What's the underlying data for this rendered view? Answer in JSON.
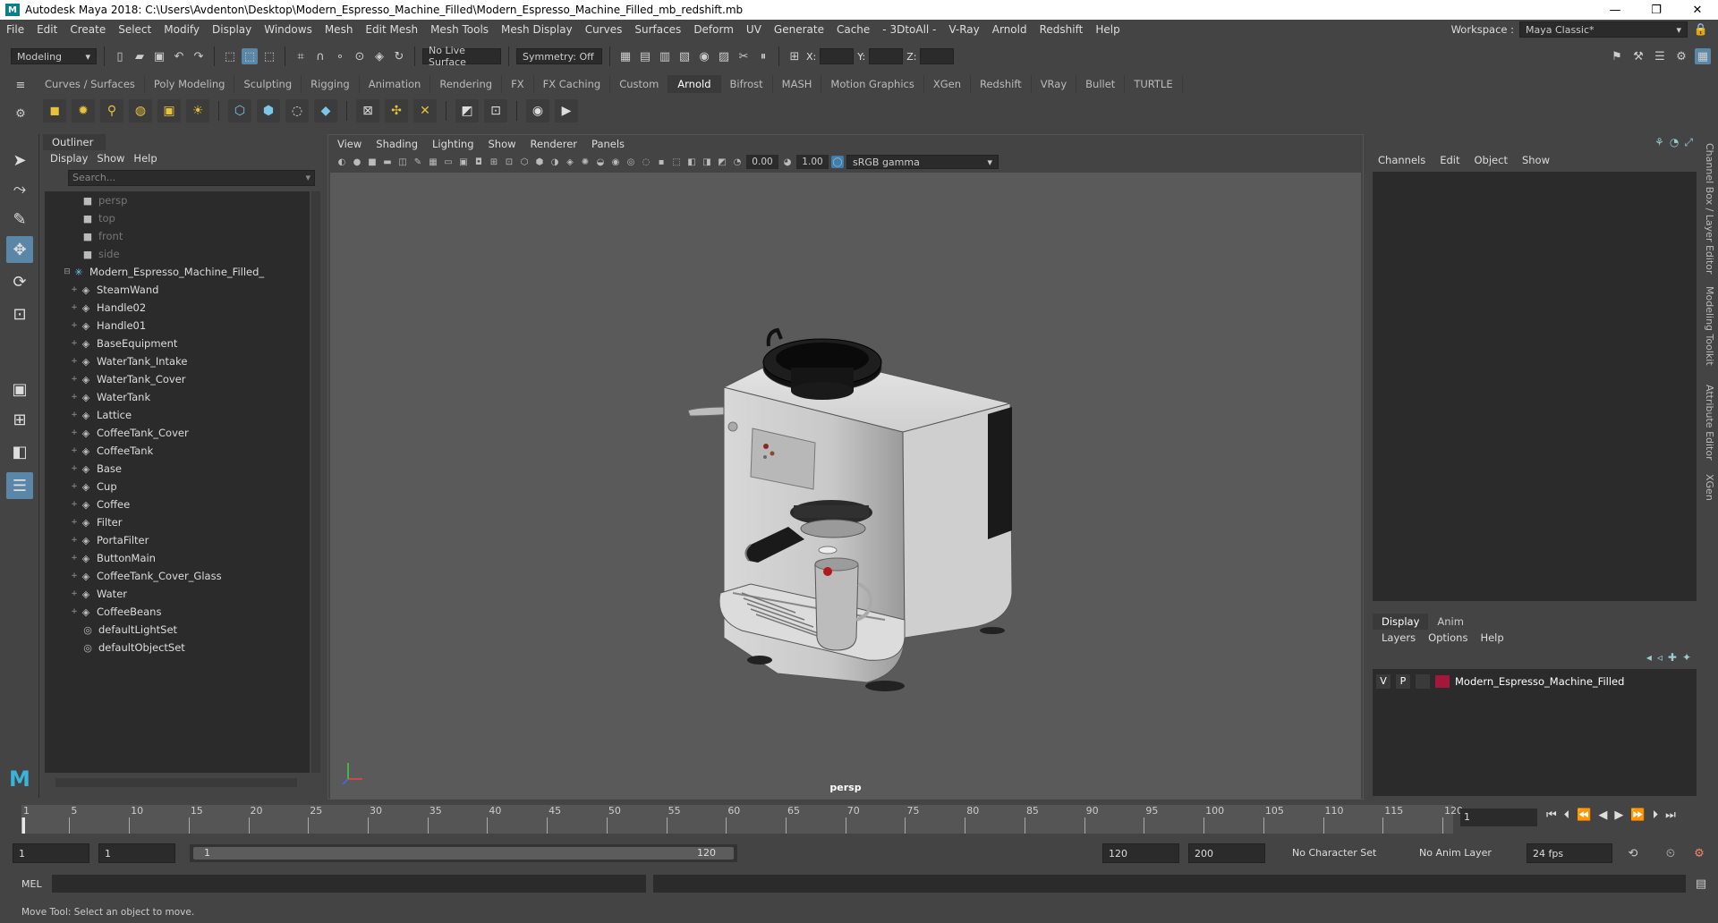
{
  "app": {
    "title": "Autodesk Maya 2018: C:\\Users\\Avdenton\\Desktop\\Modern_Espresso_Machine_Filled\\Modern_Espresso_Machine_Filled_mb_redshift.mb",
    "logo_letter": "M"
  },
  "menus": [
    "File",
    "Edit",
    "Create",
    "Select",
    "Modify",
    "Display",
    "Windows",
    "Mesh",
    "Edit Mesh",
    "Mesh Tools",
    "Mesh Display",
    "Curves",
    "Surfaces",
    "Deform",
    "UV",
    "Generate",
    "Cache",
    "- 3DtoAll -",
    "V-Ray",
    "Arnold",
    "Redshift",
    "Help"
  ],
  "workspace": {
    "label": "Workspace :",
    "value": "Maya Classic*"
  },
  "status_line": {
    "mode": "Modeling",
    "live_surface": "No Live Surface",
    "symmetry": "Symmetry: Off",
    "x_label": "X:",
    "y_label": "Y:",
    "z_label": "Z:"
  },
  "shelf_tabs": [
    "Curves / Surfaces",
    "Poly Modeling",
    "Sculpting",
    "Rigging",
    "Animation",
    "Rendering",
    "FX",
    "FX Caching",
    "Custom",
    "Arnold",
    "Bifrost",
    "MASH",
    "Motion Graphics",
    "XGen",
    "Redshift",
    "VRay",
    "Bullet",
    "TURTLE"
  ],
  "active_shelf": "Arnold",
  "outliner": {
    "title": "Outliner",
    "menu": [
      "Display",
      "Show",
      "Help"
    ],
    "search_placeholder": "Search...",
    "items": [
      {
        "label": "persp",
        "kind": "camera",
        "dim": true,
        "indent": 1
      },
      {
        "label": "top",
        "kind": "camera",
        "dim": true,
        "indent": 1
      },
      {
        "label": "front",
        "kind": "camera",
        "dim": true,
        "indent": 1
      },
      {
        "label": "side",
        "kind": "camera",
        "dim": true,
        "indent": 1
      },
      {
        "label": "Modern_Espresso_Machine_Filled_",
        "kind": "group",
        "dim": false,
        "indent": 0
      },
      {
        "label": "SteamWand",
        "kind": "mesh",
        "dim": false,
        "indent": 2
      },
      {
        "label": "Handle02",
        "kind": "mesh",
        "dim": false,
        "indent": 2
      },
      {
        "label": "Handle01",
        "kind": "mesh",
        "dim": false,
        "indent": 2
      },
      {
        "label": "BaseEquipment",
        "kind": "mesh",
        "dim": false,
        "indent": 2
      },
      {
        "label": "WaterTank_Intake",
        "kind": "mesh",
        "dim": false,
        "indent": 2
      },
      {
        "label": "WaterTank_Cover",
        "kind": "mesh",
        "dim": false,
        "indent": 2
      },
      {
        "label": "WaterTank",
        "kind": "mesh",
        "dim": false,
        "indent": 2
      },
      {
        "label": "Lattice",
        "kind": "mesh",
        "dim": false,
        "indent": 2
      },
      {
        "label": "CoffeeTank_Cover",
        "kind": "mesh",
        "dim": false,
        "indent": 2
      },
      {
        "label": "CoffeeTank",
        "kind": "mesh",
        "dim": false,
        "indent": 2
      },
      {
        "label": "Base",
        "kind": "mesh",
        "dim": false,
        "indent": 2
      },
      {
        "label": "Cup",
        "kind": "mesh",
        "dim": false,
        "indent": 2
      },
      {
        "label": "Coffee",
        "kind": "mesh",
        "dim": false,
        "indent": 2
      },
      {
        "label": "Filter",
        "kind": "mesh",
        "dim": false,
        "indent": 2
      },
      {
        "label": "PortaFilter",
        "kind": "mesh",
        "dim": false,
        "indent": 2
      },
      {
        "label": "ButtonMain",
        "kind": "mesh",
        "dim": false,
        "indent": 2
      },
      {
        "label": "CoffeeTank_Cover_Glass",
        "kind": "mesh",
        "dim": false,
        "indent": 2
      },
      {
        "label": "Water",
        "kind": "mesh",
        "dim": false,
        "indent": 2
      },
      {
        "label": "CoffeeBeans",
        "kind": "mesh",
        "dim": false,
        "indent": 2
      },
      {
        "label": "defaultLightSet",
        "kind": "set",
        "dim": false,
        "indent": 1
      },
      {
        "label": "defaultObjectSet",
        "kind": "set",
        "dim": false,
        "indent": 1
      }
    ]
  },
  "viewport": {
    "menu": [
      "View",
      "Shading",
      "Lighting",
      "Show",
      "Renderer",
      "Panels"
    ],
    "exposure": "0.00",
    "gamma": "1.00",
    "color_space": "sRGB gamma",
    "camera": "persp"
  },
  "channel_box": {
    "menu": [
      "Channels",
      "Edit",
      "Object",
      "Show"
    ]
  },
  "layer_editor": {
    "tabs": [
      "Display",
      "Anim"
    ],
    "menu": [
      "Layers",
      "Options",
      "Help"
    ],
    "layer": {
      "v": "V",
      "p": "P",
      "name": "Modern_Espresso_Machine_Filled",
      "color": "#a3173a"
    }
  },
  "side_tabs": [
    "Channel Box / Layer Editor",
    "Modeling Toolkit",
    "Attribute Editor",
    "XGen"
  ],
  "timeline": {
    "ticks": [
      "1",
      "5",
      "10",
      "15",
      "20",
      "25",
      "30",
      "35",
      "40",
      "45",
      "50",
      "55",
      "60",
      "65",
      "70",
      "75",
      "80",
      "85",
      "90",
      "95",
      "100",
      "105",
      "110",
      "115",
      "120"
    ],
    "current_frame": "1"
  },
  "range": {
    "start": "1",
    "playback_start": "1",
    "slider_start": "1",
    "slider_end": "120",
    "playback_end": "120",
    "end": "200",
    "character_set": "No Character Set",
    "anim_layer": "No Anim Layer",
    "fps": "24 fps"
  },
  "command_line": {
    "label": "MEL"
  },
  "help_line": "Move Tool: Select an object to move."
}
